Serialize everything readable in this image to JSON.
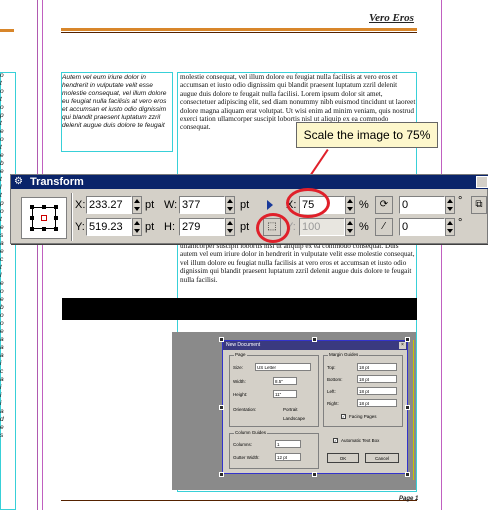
{
  "document": {
    "running_head": "Vero Eros",
    "folio": "Page 1",
    "italic_column_text": "Autem vel eum iriure dolor in hendrerit in vulputate velit esse molestie consequat, vel illum dolore eu feugiat nulla facilisis at vero eros et accumsan et iusto odio dignissim qui blandit praesent luptatum zzril delenit augue duis dolore te feugait",
    "serif_column_text": "molestie consequat, vel illum dolore eu feugiat nulla facilisis at vero eros et accumsan et iusto odio dignissim qui blandit praesent luptatum zzril delenit augue duis dolore te feugait nulla facilisi. Lorem ipsum dolor sit amet, consectetuer adipiscing elit, sed diam nonummy nibh euismod tincidunt ut laoreet dolore magna aliquam erat volutpat. Ut wisi enim ad minim veniam, quis nostrud exerci tation ullamcorper suscipit lobortis nisl ut aliquip ex ea commodo consequat.",
    "serif_column_text_2": "ullamcorper suscipit lobortis nisl ut aliquip ex ea commodo consequat. Duis autem vel eum iriure dolor in hendrerit in vulputate velit esse molestie consequat, vel illum dolore eu feugiat nulla facilisis at vero eros et accumsan et iusto odio dignissim qui blandit praesent luptatum zzril delenit augue duis dolore te feugait nulla facilisi.",
    "left_page_letters": [
      "o",
      "t",
      "o",
      "t",
      "o",
      "p",
      "t",
      "e",
      "o",
      "t",
      "e",
      "b",
      "e",
      "t",
      "l",
      "t",
      "p",
      "o",
      "t",
      "e",
      "s",
      "a",
      "e",
      "c",
      "t",
      "l",
      "e",
      "o",
      "e",
      "b",
      "o",
      "o",
      "e",
      "a",
      "a",
      "a",
      "i",
      "c",
      "a",
      "i",
      "i",
      "i",
      "a",
      "d",
      "e",
      "s"
    ]
  },
  "embedded_dialog": {
    "title": "New Document",
    "page_group": "Page",
    "size_label": "Size:",
    "size_value": "US Letter",
    "width_label": "Width:",
    "width_value": "8.5\"",
    "height_label": "Height:",
    "height_value": "11\"",
    "orientation_label": "Orientation:",
    "portrait_label": "Portrait",
    "landscape_label": "Landscape",
    "margin_group": "Margin Guides",
    "top_label": "Top:",
    "top_value": "18 pt",
    "bottom_label": "Bottom:",
    "bottom_value": "18 pt",
    "left_label": "Left:",
    "left_value": "18 pt",
    "right_label": "Right:",
    "right_value": "18 pt",
    "facing_pages_label": "Facing Pages",
    "column_group": "Column Guides",
    "columns_label": "Columns:",
    "columns_value": "1",
    "gutter_label": "Gutter Width:",
    "gutter_value": "12 pt",
    "auto_text_label": "Automatic Text Box",
    "ok_label": "OK",
    "cancel_label": "Cancel"
  },
  "transform_palette": {
    "title": "Transform",
    "x_label": "X:",
    "x_value": "233.27",
    "y_label": "Y:",
    "y_value": "519.23",
    "w_label": "W:",
    "w_value": "377",
    "h_label": "H:",
    "h_value": "279",
    "unit_pt": "pt",
    "scale_x_label": "X:",
    "scale_x_value": "75",
    "scale_y_label": "Y:",
    "scale_y_value": "100",
    "unit_percent": "%",
    "rotate_value": "0",
    "skew_value": "0",
    "unit_degree": "°"
  },
  "annotation": {
    "callout_text": "Scale the image to 75%"
  },
  "colors": {
    "palette_title_bg": "#0a246a",
    "highlight_red": "#e0202a",
    "callout_bg": "#fdf7cc",
    "guide_cyan": "#38d0d8",
    "guide_magenta": "#c060c0",
    "rule_orange": "#d8862a"
  }
}
